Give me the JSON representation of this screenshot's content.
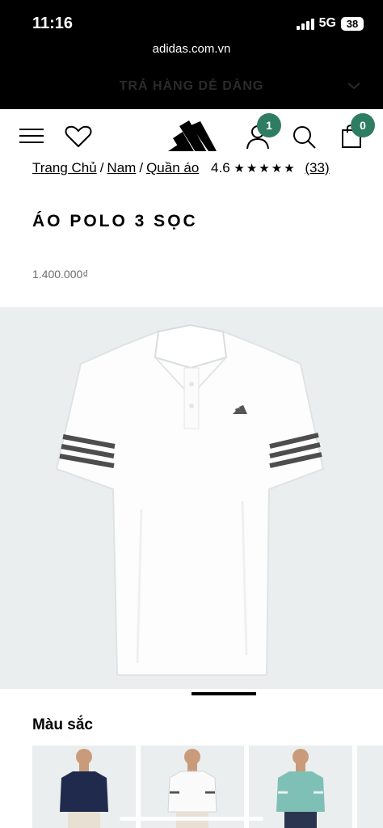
{
  "status_bar": {
    "time": "11:16",
    "network": "5G",
    "battery": "38"
  },
  "browser": {
    "url": "adidas.com.vn"
  },
  "promo": {
    "text": "TRẢ HÀNG DỄ DÀNG"
  },
  "nav": {
    "account_badge": "1",
    "cart_badge": "0"
  },
  "breadcrumb": {
    "items": [
      "Trang Chủ",
      "Nam",
      "Quần áo"
    ],
    "separator": "/",
    "rating": "4.6",
    "stars": "★★★★★",
    "review_count": "(33)"
  },
  "product": {
    "title": "ÁO POLO 3 SỌC",
    "price": "1.400.000₫"
  },
  "colors": {
    "label": "Màu sắc"
  },
  "theme": {
    "accent": "#2e7d63",
    "image_bg": "#eaeeef"
  }
}
